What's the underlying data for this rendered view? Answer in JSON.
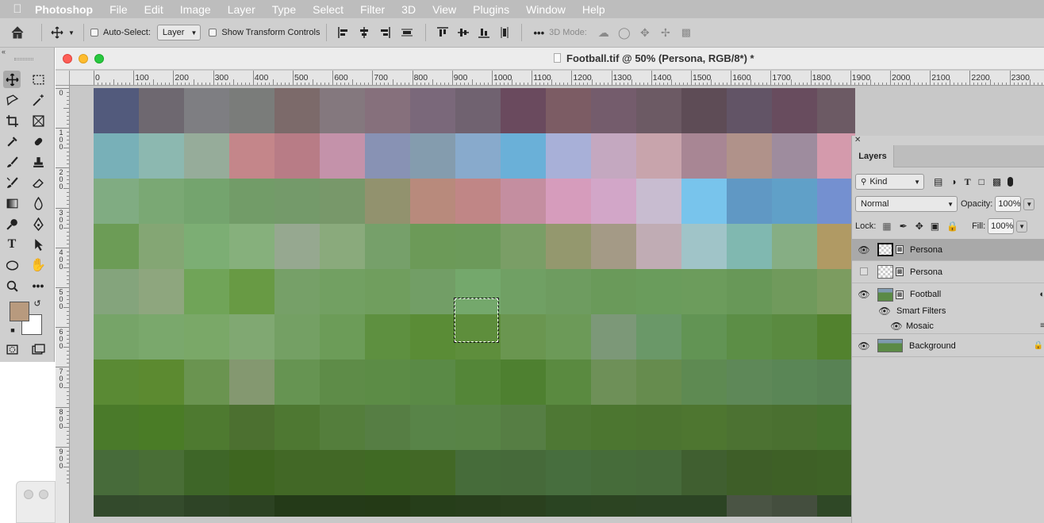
{
  "menubar": {
    "app_name": "Photoshop",
    "items": [
      "File",
      "Edit",
      "Image",
      "Layer",
      "Type",
      "Select",
      "Filter",
      "3D",
      "View",
      "Plugins",
      "Window",
      "Help"
    ]
  },
  "options_bar": {
    "auto_select_label": "Auto-Select:",
    "auto_select_value": "Layer",
    "show_transform_label": "Show Transform Controls",
    "mode_3d_label": "3D Mode:",
    "more_label": "•••"
  },
  "document": {
    "title": "Football.tif @ 50% (Persona, RGB/8*) *",
    "ruler_h": [
      "0",
      "100",
      "200",
      "300",
      "400",
      "500",
      "600",
      "700",
      "800",
      "900",
      "1000",
      "1100",
      "1200",
      "1300",
      "1400",
      "1500",
      "1600",
      "1700",
      "1800",
      "1900",
      "2000",
      "2100",
      "2200",
      "2300"
    ],
    "ruler_v": [
      "0",
      "1 0 0",
      "2 0 0",
      "3 0 0",
      "4 0 0",
      "5 0 0",
      "6 0 0",
      "7 0 0",
      "8 0 0",
      "9 0 0"
    ],
    "mosaic_rows": [
      [
        "#525a7c",
        "#6e6870",
        "#7e7e82",
        "#7a7c7a",
        "#7c6a6a",
        "#84787e",
        "#86707c",
        "#7a687a",
        "#706270",
        "#6a4a5e",
        "#7c5c64",
        "#745c6c",
        "#6c5a64",
        "#5e4c56",
        "#625466",
        "#684c5e",
        "#6c5a64"
      ],
      [
        "#78b0b8",
        "#8cb8b0",
        "#96ac9a",
        "#c4868a",
        "#b87c86",
        "#c492aa",
        "#8892b4",
        "#849cae",
        "#88aacc",
        "#6ab0d8",
        "#a8b0d8",
        "#c4a8c0",
        "#c8a4ac",
        "#a88694",
        "#b0928a",
        "#9e8c9e",
        "#d49aac"
      ],
      [
        "#80ac82",
        "#7aa874",
        "#74a46e",
        "#729c68",
        "#749a6a",
        "#78986a",
        "#92926e",
        "#b88a7c",
        "#c08686",
        "#c48ea0",
        "#d69cbc",
        "#d2a6c8",
        "#c8bcd0",
        "#78c4ec",
        "#6098c4",
        "#60a0c8",
        "#7490d0"
      ],
      [
        "#6c9c56",
        "#84a674",
        "#7cae74",
        "#86b07c",
        "#96a890",
        "#8aaa7c",
        "#76a06a",
        "#6c9a58",
        "#6c9a5a",
        "#7a9e66",
        "#94986e",
        "#a49a86",
        "#c0acb4",
        "#a0c4c8",
        "#80b8b0",
        "#86ae84",
        "#b09a64"
      ],
      [
        "#84a47c",
        "#8ea67e",
        "#70a458",
        "#689a44",
        "#76a068",
        "#72a062",
        "#709e5e",
        "#729e66",
        "#74a86c",
        "#70a064",
        "#6e9c60",
        "#6a9a5a",
        "#6a9c5c",
        "#6c9c5c",
        "#689858",
        "#709a5c",
        "#7c9c60"
      ],
      [
        "#76a468",
        "#7aa86c",
        "#7aa868",
        "#80a872",
        "#74a064",
        "#6c9c58",
        "#5e9040",
        "#5a8c36",
        "#5e8e3c",
        "#6a9650",
        "#6c9a58",
        "#7c9878",
        "#6a9868",
        "#629454",
        "#5c8e46",
        "#5a8a40",
        "#52822e"
      ],
      [
        "#5a8a34",
        "#5c8a30",
        "#6a9450",
        "#849870",
        "#669452",
        "#5e8c48",
        "#5c8c46",
        "#5a8a46",
        "#548638",
        "#4e8030",
        "#5a8a40",
        "#6e9058",
        "#668c4e",
        "#5e8a52",
        "#5e8858",
        "#5a8656",
        "#588254"
      ],
      [
        "#4a7a2a",
        "#4a7c26",
        "#4e7a30",
        "#4c7030",
        "#4e7832",
        "#547e3c",
        "#567e44",
        "#588448",
        "#588446",
        "#567e44",
        "#4e7834",
        "#4c7630",
        "#4c7430",
        "#4e7630",
        "#4c7232",
        "#4a7030",
        "#46722e"
      ],
      [
        "#476b3a",
        "#496e36",
        "#3e6628",
        "#3e6620",
        "#426826",
        "#426826",
        "#406a24",
        "#426826",
        "#466c3a",
        "#466a3a",
        "#476e3e",
        "#466c3a",
        "#466a3a",
        "#405f30",
        "#3e5e28",
        "#3e6026",
        "#3e6226"
      ],
      [
        "#334a2c",
        "#344b2c",
        "#2e4426",
        "#2c4222",
        "#243a18",
        "#243a18",
        "#243a16",
        "#263e1a",
        "#283e1c",
        "#2a401e",
        "#2a4422",
        "#2c4422",
        "#2c4424",
        "#2c4424",
        "#4a5444",
        "#444e3e",
        "#2f4826"
      ]
    ]
  },
  "layers_panel": {
    "tab": "Layers",
    "filter_kind": "Kind",
    "blend_mode": "Normal",
    "opacity_label": "Opacity:",
    "opacity_value": "100%",
    "lock_label": "Lock:",
    "fill_label": "Fill:",
    "fill_value": "100%",
    "layers": [
      {
        "name": "Persona",
        "visible": true,
        "selected": true
      },
      {
        "name": "Persona",
        "visible": false,
        "selected": false
      },
      {
        "name": "Football",
        "visible": true,
        "selected": false
      },
      {
        "name": "Smart Filters",
        "visible": true,
        "selected": false
      },
      {
        "name": "Mosaic",
        "visible": true,
        "selected": false
      },
      {
        "name": "Background",
        "visible": true,
        "selected": false
      }
    ]
  },
  "colors": {
    "foreground": "#b89a7e",
    "background": "#ffffff"
  }
}
